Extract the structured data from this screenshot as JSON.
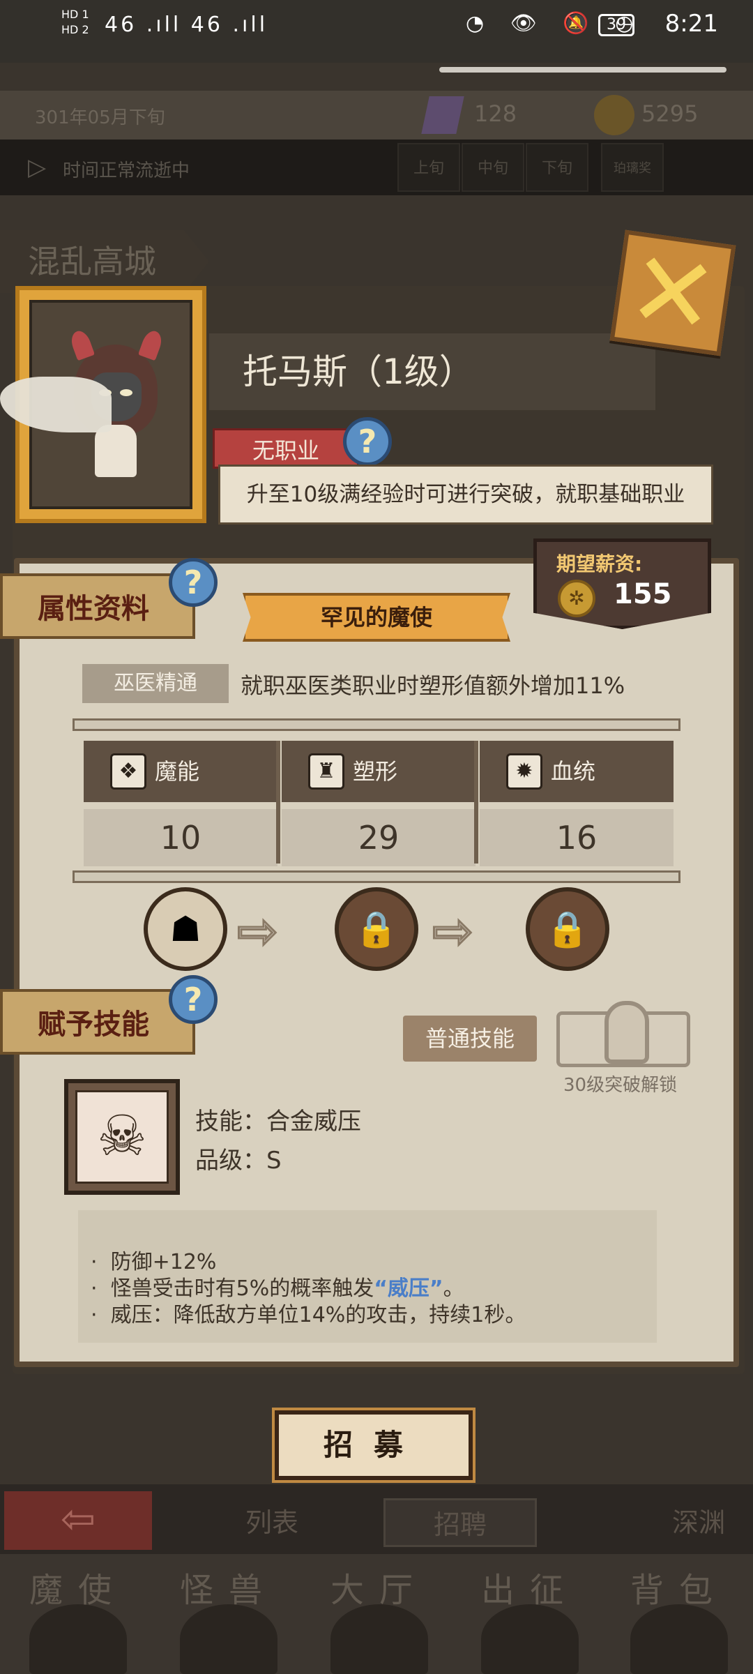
{
  "status_bar": {
    "left_top": "HD 1",
    "left_bottom": "HD 2",
    "signal": "46 .ıll 46 .ıll",
    "right_icons": "◔ 👁 🔕 ◷",
    "battery": "39",
    "time": "8:21"
  },
  "background": {
    "date": "301年05月下旬",
    "crystals": "128",
    "coins": "5295",
    "time_status": "时间正常流逝中",
    "period_cells": [
      "上旬",
      "中旬",
      "下旬"
    ],
    "shop_label": "珀璃奖",
    "region": "混乱高城"
  },
  "character": {
    "name": "托马斯（1级）",
    "job": "无职业",
    "job_hint": "升至10级满经验时可进行突破，就职基础职业"
  },
  "attributes": {
    "section_title": "属性资料",
    "salary_label": "期望薪资:",
    "salary_value": "155",
    "rarity": "罕见的魔使",
    "trait_name": "巫医精通",
    "trait_desc": "就职巫医类职业时塑形值额外增加11%",
    "stats": [
      {
        "label": "魔能",
        "value": "10"
      },
      {
        "label": "塑形",
        "value": "29"
      },
      {
        "label": "血统",
        "value": "16"
      }
    ]
  },
  "skills": {
    "section_title": "赋予技能",
    "normal_button": "普通技能",
    "locked_caption": "30级突破解锁",
    "skill_name_line": "技能：合金威压",
    "grade_line": "品级：S",
    "desc": [
      {
        "pre": "防御+12%",
        "hl": "",
        "post": ""
      },
      {
        "pre": "怪兽受击时有5%的概率触发",
        "hl": "“威压”",
        "post": "。"
      },
      {
        "pre": "威压：降低敌方单位14%的攻击，持续1秒。",
        "hl": "",
        "post": ""
      }
    ],
    "bullet": "·"
  },
  "recruit_button": "招募",
  "bottom_tabs": [
    "列表",
    "招聘",
    "深渊"
  ],
  "nav": [
    "魔使",
    "怪兽",
    "大厅",
    "出征",
    "背包"
  ],
  "icons": {
    "help": "?",
    "close": "✕",
    "back": "⇦",
    "arrow": "⇨",
    "lock": "🔒"
  },
  "colors": {
    "accent": "#e8a546",
    "link": "#4a7ec8",
    "job_tag": "#b5423f"
  }
}
